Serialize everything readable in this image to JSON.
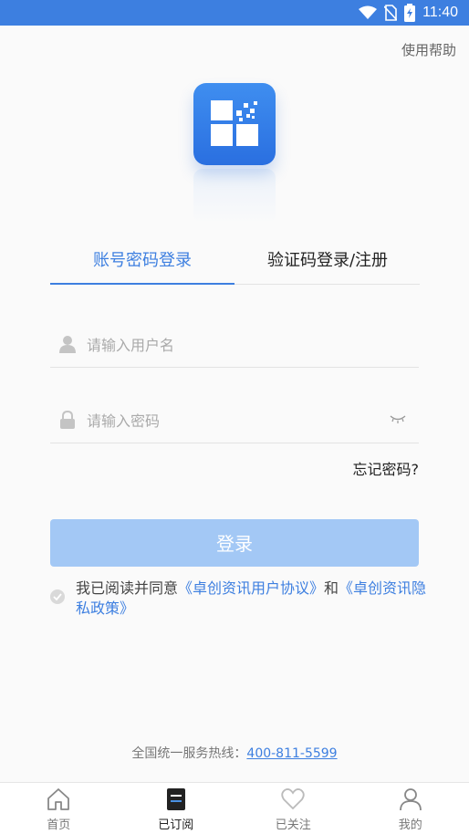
{
  "status_bar": {
    "time": "11:40",
    "icons": [
      "wifi-icon",
      "no-sim-icon",
      "battery-charging-icon"
    ]
  },
  "header": {
    "help_label": "使用帮助"
  },
  "tabs": [
    {
      "label": "账号密码登录",
      "active": true
    },
    {
      "label": "验证码登录/注册",
      "active": false
    }
  ],
  "form": {
    "username_placeholder": "请输入用户名",
    "password_placeholder": "请输入密码",
    "forgot_label": "忘记密码?",
    "login_label": "登录"
  },
  "agreement": {
    "prefix": "我已阅读并同意",
    "link1": "《卓创资讯用户协议》",
    "middle": "和",
    "link2": "《卓创资讯隐私政策》"
  },
  "hotline": {
    "label": "全国统一服务热线：",
    "phone": "400-811-5599"
  },
  "bottom_nav": [
    {
      "label": "首页",
      "icon": "home-icon",
      "active": false
    },
    {
      "label": "已订阅",
      "icon": "subscribed-icon",
      "active": true
    },
    {
      "label": "已关注",
      "icon": "heart-icon",
      "active": false
    },
    {
      "label": "我的",
      "icon": "user-icon",
      "active": false
    }
  ],
  "colors": {
    "accent": "#3d7fe0",
    "button_disabled": "#a3c8f5",
    "status_bar": "#3d7fe0"
  }
}
